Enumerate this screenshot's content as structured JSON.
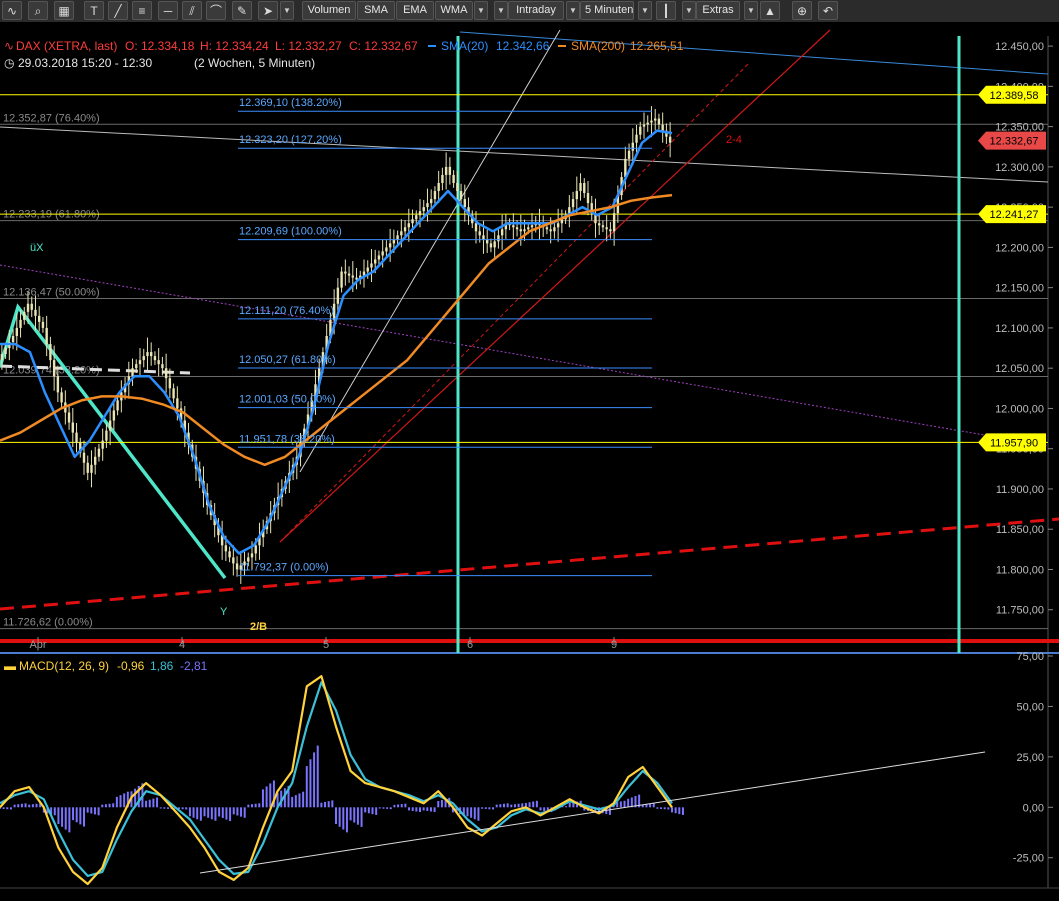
{
  "toolbar": {
    "volumen": "Volumen",
    "sma": "SMA",
    "ema": "EMA",
    "wma": "WMA",
    "intraday": "Intraday",
    "interval": "5 Minuten",
    "extras": "Extras",
    "icons": [
      "wave-icon",
      "search-icon",
      "grid-icon",
      "text-tool-icon",
      "line-tool-icon",
      "fibonacci-tool-icon",
      "horizontal-line-icon",
      "channel-tool-icon",
      "arc-tool-icon",
      "pencil-icon",
      "cursor-icon",
      "zoom-icon",
      "undo-icon"
    ]
  },
  "header": {
    "instrument": "DAX (XETRA, last)",
    "open": "O: 12.334,18",
    "high": "H: 12.334,24",
    "low": "L: 12.332,27",
    "close": "C: 12.332,67",
    "sma20": "SMA(20)",
    "sma20_val": "12.342,66",
    "sma200": "SMA(200)",
    "sma200_val": "12.265,51",
    "range": "29.03.2018 15:20 - 12:30",
    "period": "(2 Wochen, 5 Minuten)"
  },
  "colors": {
    "candles": "#e8e4b4",
    "sma20": "#2b8fff",
    "sma200": "#f08a24",
    "fib": "#3b8dff",
    "fib_text": "#5aa8ff",
    "price_line": "#ffff00",
    "trend_red": "#e01010",
    "vertical": "#4ee6c8",
    "macd": "#ffd23c",
    "signal": "#3cc0d8",
    "histogram": "#7a74ff"
  },
  "chart_data": [
    {
      "type": "line",
      "ylim": [
        11700,
        12470
      ],
      "y_ticks": [
        11750,
        11800,
        11850,
        11900,
        11950,
        12000,
        12050,
        12100,
        12150,
        12200,
        12250,
        12300,
        12350,
        12400,
        12450
      ],
      "y_tick_labels": [
        "11.750,00",
        "11.800,00",
        "11.850,00",
        "11.900,00",
        "11.950,00",
        "12.000,00",
        "12.050,00",
        "12.100,00",
        "12.150,00",
        "12.200,00",
        "12.250,00",
        "12.300,00",
        "12.350,00",
        "12.400,00",
        "12.450,00"
      ],
      "x_tick_labels": [
        "Apr",
        "4",
        "5",
        "6",
        "9"
      ],
      "grid": false,
      "series": [
        {
          "name": "DAX (XETRA, last)",
          "values": [
            12060,
            12090,
            12130,
            12100,
            12020,
            11970,
            11920,
            11960,
            12010,
            12050,
            12070,
            12050,
            12000,
            11940,
            11880,
            11830,
            11800,
            11820,
            11860,
            11900,
            11940,
            12010,
            12090,
            12170,
            12160,
            12180,
            12200,
            12220,
            12240,
            12260,
            12300,
            12260,
            12220,
            12200,
            12230,
            12220,
            12230,
            12220,
            12240,
            12280,
            12230,
            12220,
            12310,
            12350,
            12360,
            12330
          ]
        },
        {
          "name": "SMA(20)",
          "values": [
            12080,
            12080,
            12070,
            12020,
            11980,
            11940,
            11960,
            11990,
            12020,
            12040,
            12040,
            12020,
            11990,
            11940,
            11880,
            11840,
            11820,
            11830,
            11860,
            11900,
            11940,
            12000,
            12080,
            12140,
            12160,
            12170,
            12190,
            12210,
            12230,
            12250,
            12270,
            12250,
            12230,
            12220,
            12230,
            12230,
            12230,
            12230,
            12240,
            12250,
            12240,
            12250,
            12290,
            12330,
            12345,
            12342
          ]
        },
        {
          "name": "SMA(200)",
          "values": [
            11960,
            11970,
            11985,
            12000,
            12010,
            12015,
            12015,
            12012,
            12005,
            11995,
            11975,
            11955,
            11940,
            11930,
            11940,
            11960,
            11980,
            12000,
            12020,
            12040,
            12060,
            12090,
            12120,
            12150,
            12180,
            12200,
            12220,
            12230,
            12240,
            12245,
            12250,
            12258,
            12262,
            12265
          ]
        }
      ],
      "fib_levels": [
        {
          "label": "12.369,10 (138.20%)",
          "value": 12369.1
        },
        {
          "label": "12.323,20 (127.20%)",
          "value": 12323.2
        },
        {
          "label": "12.209,69 (100.00%)",
          "value": 12209.69
        },
        {
          "label": "12.111,20 (76.40%)",
          "value": 12111.2
        },
        {
          "label": "12.050,27 (61.80%)",
          "value": 12050.27
        },
        {
          "label": "12.001,03 (50.00%)",
          "value": 12001.03
        },
        {
          "label": "11.951,78 (38.20%)",
          "value": 11951.78
        },
        {
          "label": "11.792,37 (0.00%)",
          "value": 11792.37
        }
      ],
      "left_fib_levels": [
        {
          "label": "12.352,87 (76.40%)",
          "value": 12352.87
        },
        {
          "label": "12.233,19 (61.80%)",
          "value": 12233.19
        },
        {
          "label": "12.136,47 (50.00%)",
          "value": 12136.47
        },
        {
          "label": "12.039,74 (38.20%)",
          "value": 12039.74
        },
        {
          "label": "11.726,62 (0.00%)",
          "value": 11726.62
        }
      ],
      "price_tags": [
        {
          "label": "12.389,58",
          "value": 12389.58,
          "kind": "level"
        },
        {
          "label": "12.332,67",
          "value": 12332.67,
          "kind": "last"
        },
        {
          "label": "12.241,27",
          "value": 12241.27,
          "kind": "level"
        },
        {
          "label": "11.957,90",
          "value": 11957.9,
          "kind": "level"
        }
      ],
      "annotations": [
        "üX",
        "Y",
        "2/B",
        "2-4"
      ]
    },
    {
      "type": "line",
      "title": "MACD(12, 26, 9)",
      "values_text": [
        "-0,96",
        "1,86",
        "-2,81"
      ],
      "ylim": [
        -40,
        75
      ],
      "y_ticks": [
        75,
        50,
        25,
        0,
        -25
      ],
      "y_tick_labels": [
        "75,00",
        "50,00",
        "25,00",
        "0,00",
        "-25,00"
      ],
      "series": [
        {
          "name": "MACD",
          "values": [
            0,
            8,
            10,
            0,
            -20,
            -32,
            -38,
            -30,
            -10,
            5,
            12,
            6,
            -2,
            -10,
            -20,
            -32,
            -36,
            -30,
            -10,
            8,
            18,
            60,
            65,
            40,
            18,
            12,
            10,
            8,
            5,
            2,
            8,
            0,
            -10,
            -14,
            -8,
            -2,
            0,
            -4,
            0,
            4,
            0,
            -3,
            2,
            15,
            20,
            10,
            0
          ]
        },
        {
          "name": "Signal",
          "values": [
            2,
            6,
            8,
            4,
            -12,
            -26,
            -34,
            -32,
            -16,
            -2,
            8,
            6,
            0,
            -6,
            -16,
            -26,
            -33,
            -32,
            -18,
            0,
            12,
            40,
            62,
            48,
            26,
            14,
            10,
            8,
            6,
            3,
            6,
            2,
            -6,
            -12,
            -10,
            -4,
            -1,
            -3,
            -1,
            3,
            1,
            -1,
            1,
            10,
            18,
            12,
            2
          ]
        }
      ]
    }
  ]
}
